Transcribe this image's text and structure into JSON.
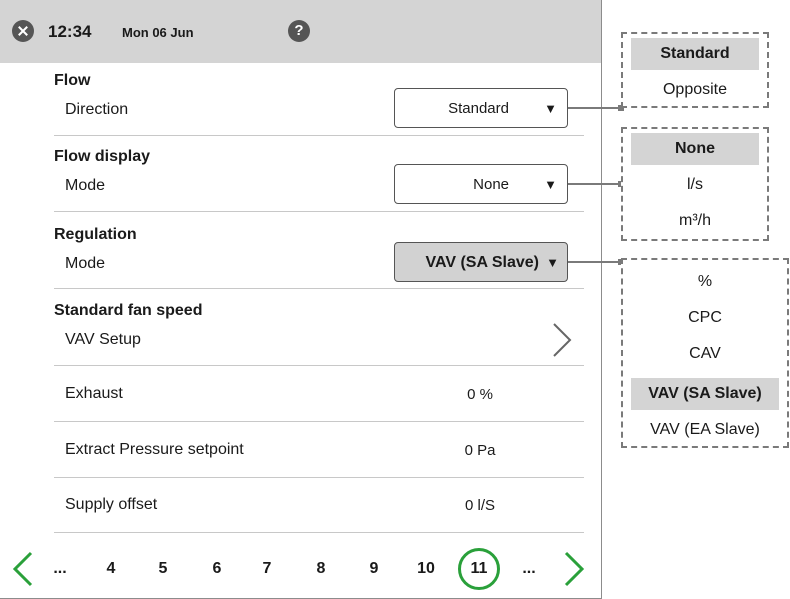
{
  "header": {
    "time": "12:34",
    "date": "Mon 06 Jun",
    "close_icon": "close-icon",
    "help_icon": "help-icon",
    "help_glyph": "?"
  },
  "sections": {
    "flow": {
      "title": "Flow",
      "label": "Direction",
      "value": "Standard",
      "arrow": "▼"
    },
    "flow_display": {
      "title": "Flow display",
      "label": "Mode",
      "value": "None",
      "arrow": "▼"
    },
    "regulation": {
      "title": "Regulation",
      "label": "Mode",
      "value": "VAV (SA Slave)",
      "arrow": "▼"
    },
    "fan_speed": {
      "title": "Standard fan speed",
      "label": "VAV Setup"
    },
    "exhaust": {
      "label": "Exhaust",
      "value": "0 %"
    },
    "extract_pressure": {
      "label": "Extract Pressure setpoint",
      "value": "0 Pa"
    },
    "supply_offset": {
      "label": "Supply offset",
      "value": "0 l/S"
    }
  },
  "pager": {
    "items": [
      "...",
      "4",
      "5",
      "6",
      "7",
      "8",
      "9",
      "10",
      "11",
      "..."
    ],
    "current": "11",
    "accent": "#2aa03a"
  },
  "popups": {
    "direction_options": [
      "Standard",
      "Opposite"
    ],
    "direction_selected": "Standard",
    "display_options": [
      "None",
      "l/s",
      "m³/h"
    ],
    "display_selected": "None",
    "regulation_options": [
      "%",
      "CPC",
      "CAV",
      "VAV (SA Slave)",
      "VAV (EA Slave)"
    ],
    "regulation_selected": "VAV (SA Slave)"
  },
  "colors": {
    "header_bg": "#d4d4d4",
    "selected_bg": "#d4d4d4",
    "accent_green": "#2aa03a",
    "dashed_border": "#7a7a7a"
  }
}
